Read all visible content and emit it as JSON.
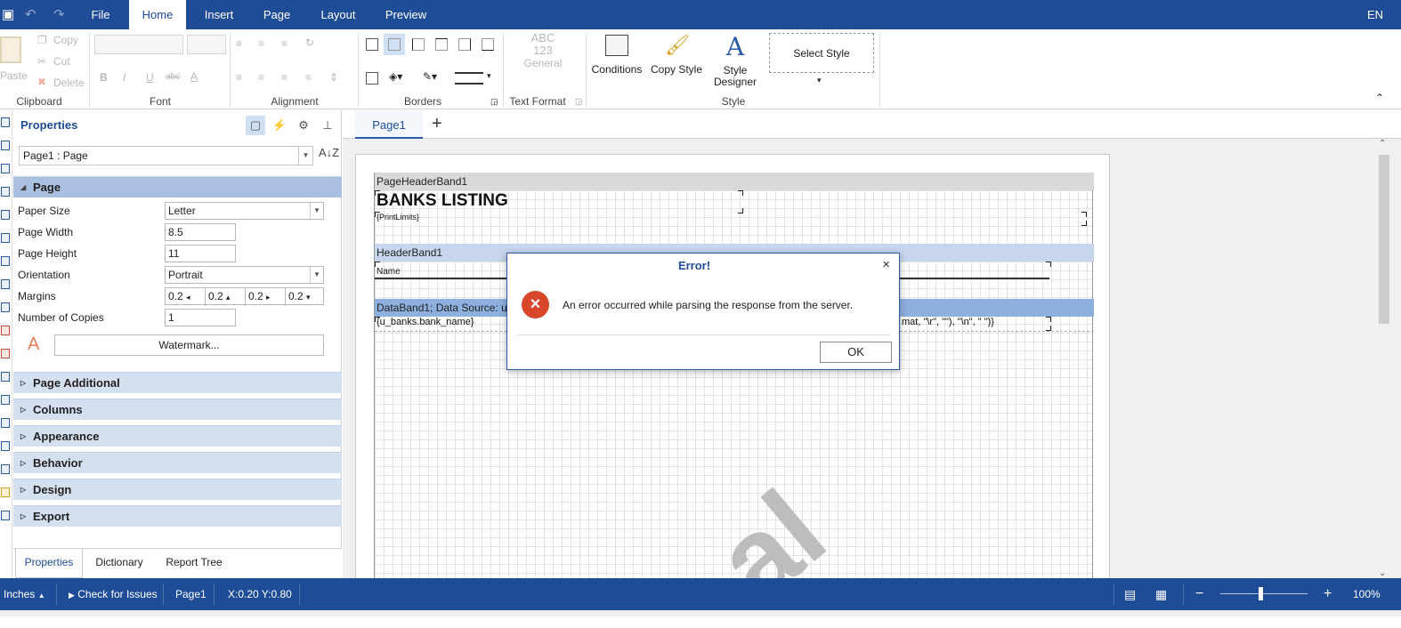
{
  "titlebar": {
    "tabs": [
      "File",
      "Home",
      "Insert",
      "Page",
      "Layout",
      "Preview"
    ],
    "active_tab": "Home",
    "language": "EN"
  },
  "ribbon": {
    "clipboard": {
      "paste": "Paste",
      "copy": "Copy",
      "cut": "Cut",
      "delete": "Delete",
      "label": "Clipboard"
    },
    "font": {
      "bold": "B",
      "italic": "I",
      "underline": "U",
      "strike": "abc",
      "color": "A",
      "label": "Font"
    },
    "alignment": {
      "label": "Alignment"
    },
    "borders": {
      "label": "Borders"
    },
    "text_format": {
      "preview_line1": "ABC",
      "preview_line2": "123",
      "general": "General",
      "label": "Text Format"
    },
    "style": {
      "conditions": "Conditions",
      "copy_style": "Copy Style",
      "designer_line1": "Style",
      "designer_line2": "Designer",
      "select_style": "Select Style",
      "label": "Style"
    }
  },
  "properties": {
    "title": "Properties",
    "object_selector": "Page1 : Page",
    "categories": {
      "page": "Page",
      "page_additional": "Page Additional",
      "columns": "Columns",
      "appearance": "Appearance",
      "behavior": "Behavior",
      "design": "Design",
      "export": "Export"
    },
    "fields": {
      "paper_size_label": "Paper Size",
      "paper_size_value": "Letter",
      "page_width_label": "Page Width",
      "page_width_value": "8.5",
      "page_height_label": "Page Height",
      "page_height_value": "11",
      "orientation_label": "Orientation",
      "orientation_value": "Portrait",
      "margins_label": "Margins",
      "margins_values": [
        "0.2",
        "0.2",
        "0.2",
        "0.2"
      ],
      "copies_label": "Number of Copies",
      "copies_value": "1"
    },
    "watermark_button": "Watermark...",
    "bottom_tabs": [
      "Properties",
      "Dictionary",
      "Report Tree"
    ],
    "active_bottom_tab": "Properties"
  },
  "designer": {
    "page_tab": "Page1",
    "add_tab": "+",
    "bands": {
      "page_header": "PageHeaderBand1",
      "title_text": "BANKS LISTING",
      "print_limits": "{PrintLimits}",
      "header": "HeaderBand1",
      "name_col": "Name",
      "data_band": "DataBand1; Data Source: u",
      "bank_name": "{u_banks.bank_name}",
      "format_fragment": "mat, \"\\r\", \"\"), \"\\n\", \" \")}"
    },
    "watermark_text": "al"
  },
  "dialog": {
    "title": "Error!",
    "message": "An error occurred while parsing the response from the server.",
    "ok_button": "OK",
    "close_glyph": "×",
    "error_glyph": "×",
    "error_color": "#d9472b"
  },
  "statusbar": {
    "units": "Inches",
    "check_issues": "Check for Issues",
    "page": "Page1",
    "coords": "X:0.20 Y:0.80",
    "zoom_out": "−",
    "zoom_in": "+",
    "zoom": "100%"
  },
  "colors": {
    "accent": "#1e4c96",
    "selected": "#cfe0f5"
  }
}
